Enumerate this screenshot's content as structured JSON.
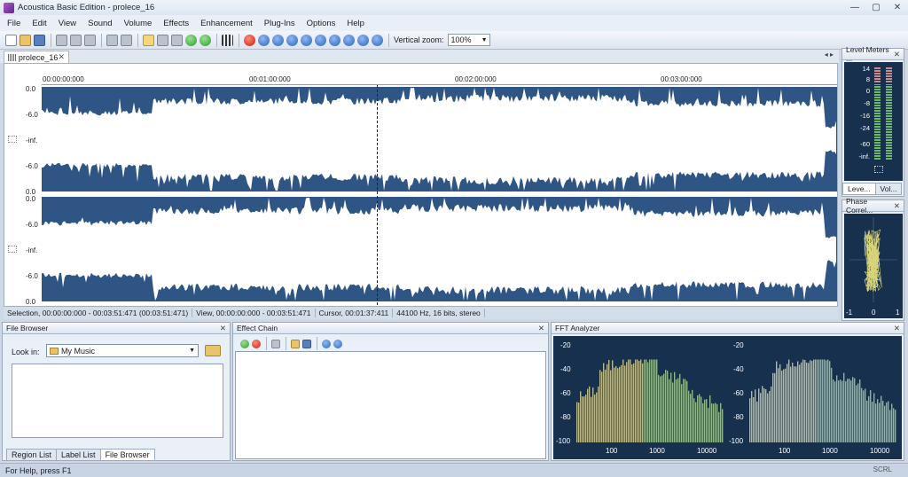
{
  "window": {
    "title": "Acoustica Basic Edition - prolece_16"
  },
  "menu": [
    "File",
    "Edit",
    "View",
    "Sound",
    "Volume",
    "Effects",
    "Enhancement",
    "Plug-Ins",
    "Options",
    "Help"
  ],
  "toolbar": {
    "zoom_label": "Vertical zoom:",
    "zoom_value": "100%"
  },
  "document_tab": {
    "name": "prolece_16"
  },
  "ruler": [
    "00:00:00:000",
    "00:01:00:000",
    "00:02:00:000",
    "00:03:00:000"
  ],
  "db_labels": [
    "0.0",
    "-6.0",
    "-inf.",
    "-6.0",
    "0.0"
  ],
  "status_strip": {
    "selection": "Selection, 00:00:00:000 - 00:03:51:471 (00:03:51:471)",
    "view": "View, 00:00:00:000 - 00:03:51:471",
    "cursor": "Cursor, 00:01:37:411",
    "format": "44100 Hz, 16 bits, stereo"
  },
  "level_meters": {
    "title": "Level Meters ...",
    "scale": [
      "14",
      "8",
      "0",
      "-8",
      "-16",
      "-24",
      "-60",
      "-inf."
    ],
    "tabs": [
      "Leve...",
      "Vol..."
    ]
  },
  "phase_correlation": {
    "title": "Phase Correl...",
    "scale": [
      "-1",
      "0",
      "1"
    ]
  },
  "file_browser": {
    "title": "File Browser",
    "look_in_label": "Look in:",
    "look_in_value": "My Music",
    "tabs": [
      "Region List",
      "Label List",
      "File Browser"
    ]
  },
  "effect_chain": {
    "title": "Effect Chain"
  },
  "fft": {
    "title": "FFT Analyzer",
    "y_labels": [
      "-20",
      "-40",
      "-60",
      "-80",
      "-100"
    ],
    "x_labels": [
      "100",
      "1000",
      "10000"
    ]
  },
  "statusbar": {
    "help": "For Help, press F1",
    "scrl": "SCRL"
  },
  "colors": {
    "waveform_bg": "#2f5584",
    "wave_fill": "#ffffff",
    "meter_green": "#6fb56b",
    "panel_dark": "#17304d"
  }
}
